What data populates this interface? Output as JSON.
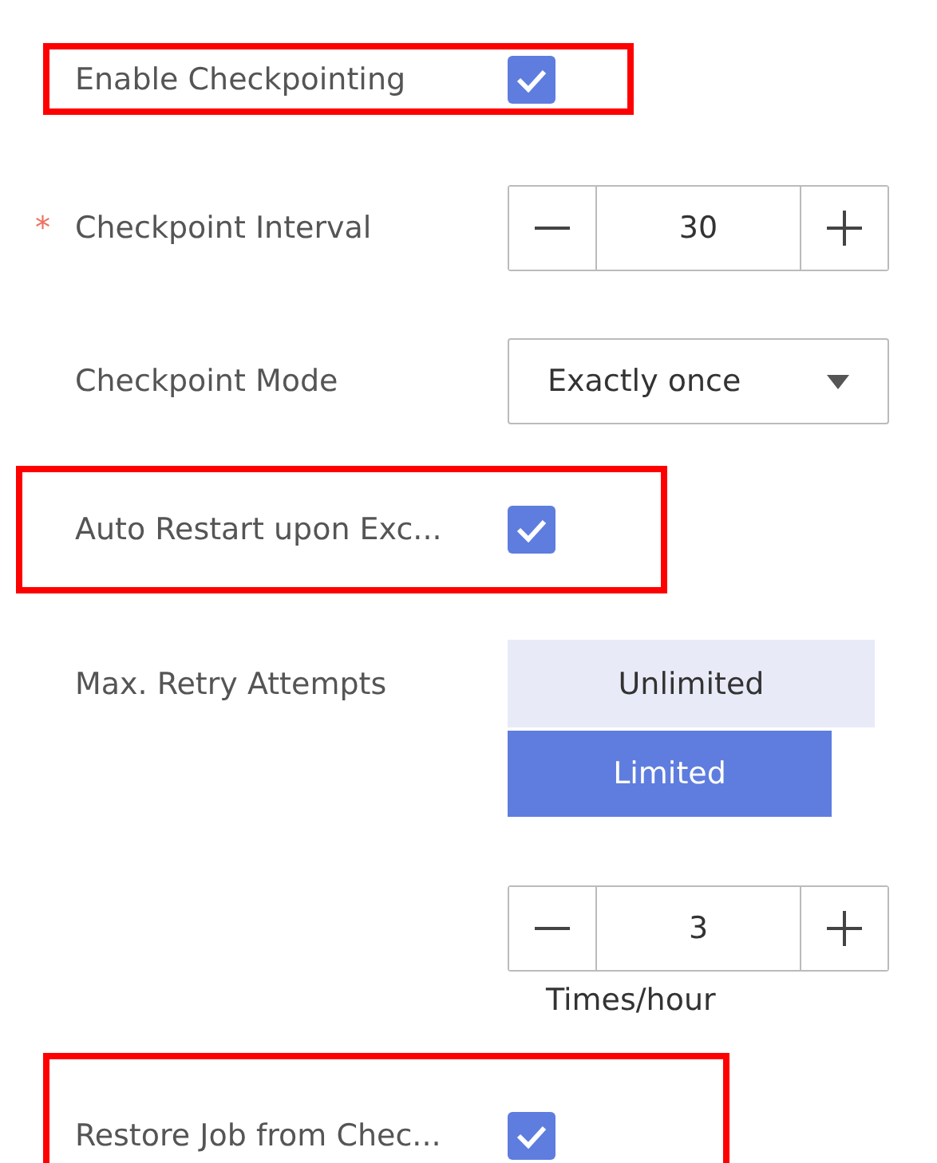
{
  "rows": [
    {
      "kind": "checkbox",
      "label": "Enable Checkpointing",
      "checked": true,
      "highlighted": true
    },
    {
      "kind": "stepper",
      "label": "Checkpoint Interval",
      "required_mark": "*",
      "value": "30"
    },
    {
      "kind": "select",
      "label": "Checkpoint Mode",
      "value": "Exactly once"
    },
    {
      "kind": "checkbox",
      "label": "Auto Restart upon Exc...",
      "checked": true,
      "highlighted": true
    },
    {
      "kind": "segmented",
      "label": "Max. Retry Attempts",
      "options": [
        {
          "label": "Unlimited",
          "selected": false
        },
        {
          "label": "Limited",
          "selected": true
        }
      ]
    },
    {
      "kind": "stepper",
      "value": "3"
    },
    {
      "kind": "note",
      "text": "Times/hour"
    },
    {
      "kind": "checkbox",
      "label": "Restore Job from Chec...",
      "checked": true,
      "highlighted": true
    }
  ]
}
